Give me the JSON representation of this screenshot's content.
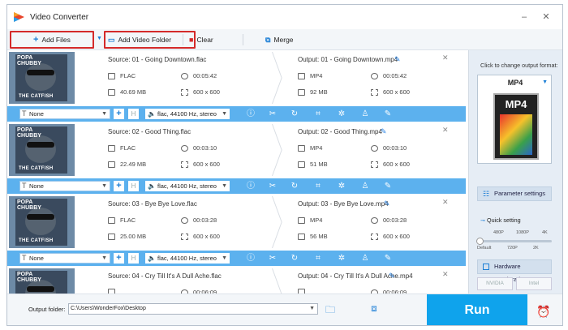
{
  "window": {
    "title": "Video Converter"
  },
  "toolbar": {
    "add_files": "Add Files",
    "add_video_folder": "Add Video Folder",
    "clear": "Clear",
    "merge": "Merge"
  },
  "items": [
    {
      "cover_title": "POPA CHUBBY",
      "cover_sub": "THE CATFISH",
      "source": "Source: 01 - Going Downtown.flac",
      "output": "Output: 01 - Going Downtown.mp4",
      "src_format": "FLAC",
      "src_duration": "00:05:42",
      "src_size": "40.69 MB",
      "src_res": "600 x 600",
      "out_format": "MP4",
      "out_duration": "00:05:42",
      "out_size": "92 MB",
      "out_res": "600 x 600",
      "subtitle": "None",
      "audio": "flac, 44100 Hz, stereo"
    },
    {
      "cover_title": "POPA CHUBBY",
      "cover_sub": "THE CATFISH",
      "source": "Source: 02 - Good Thing.flac",
      "output": "Output: 02 - Good Thing.mp4",
      "src_format": "FLAC",
      "src_duration": "00:03:10",
      "src_size": "22.49 MB",
      "src_res": "600 x 600",
      "out_format": "MP4",
      "out_duration": "00:03:10",
      "out_size": "51 MB",
      "out_res": "600 x 600",
      "subtitle": "None",
      "audio": "flac, 44100 Hz, stereo"
    },
    {
      "cover_title": "POPA CHUBBY",
      "cover_sub": "THE CATFISH",
      "source": "Source: 03 - Bye Bye Love.flac",
      "output": "Output: 03 - Bye Bye Love.mp4",
      "src_format": "FLAC",
      "src_duration": "00:03:28",
      "src_size": "25.00 MB",
      "src_res": "600 x 600",
      "out_format": "MP4",
      "out_duration": "00:03:28",
      "out_size": "56 MB",
      "out_res": "600 x 600",
      "subtitle": "None",
      "audio": "flac, 44100 Hz, stereo"
    },
    {
      "cover_title": "POPA CHUBBY",
      "cover_sub": "",
      "source": "Source: 04 - Cry Till It's A Dull Ache.flac",
      "output": "Output: 04 - Cry Till It's A Dull Ache.mp4",
      "src_format": "",
      "src_duration": "00:06:09",
      "src_size": "",
      "src_res": "",
      "out_format": "",
      "out_duration": "00:06:09",
      "out_size": "",
      "out_res": "",
      "subtitle": "",
      "audio": ""
    }
  ],
  "panel": {
    "header": "Click to change output format:",
    "format": "MP4",
    "format_badge": "MP4",
    "parameter_settings": "Parameter settings",
    "quick_setting": "Quick setting",
    "ticks_top": [
      "480P",
      "1080P",
      "4K"
    ],
    "ticks_bottom": [
      "Default",
      "720P",
      "2K"
    ],
    "hardware_acceleration": "Hardware acceleration",
    "gpu1": "NVIDIA",
    "gpu2": "Intel"
  },
  "footer": {
    "output_folder_label": "Output folder:",
    "output_folder_path": "C:\\Users\\WonderFox\\Desktop",
    "run": "Run"
  }
}
